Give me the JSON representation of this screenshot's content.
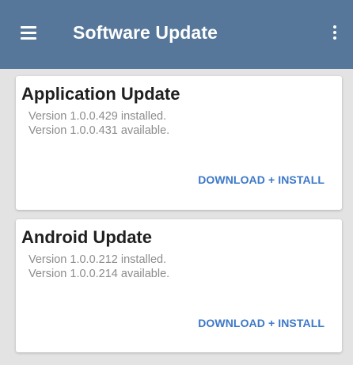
{
  "app_bar": {
    "title": "Software Update",
    "menu_icon": "hamburger-menu-icon",
    "overflow_icon": "more-vertical-icon",
    "background_color": "#56779a"
  },
  "cards": [
    {
      "title": "Application Update",
      "installed": "Version 1.0.0.429 installed.",
      "available": "Version 1.0.0.431 available.",
      "action_label": "DOWNLOAD + INSTALL"
    },
    {
      "title": "Android Update",
      "installed": "Version 1.0.0.212 installed.",
      "available": "Version 1.0.0.214 available.",
      "action_label": "DOWNLOAD + INSTALL"
    }
  ],
  "colors": {
    "accent": "#3c78c8",
    "background": "#e3e3e3"
  }
}
